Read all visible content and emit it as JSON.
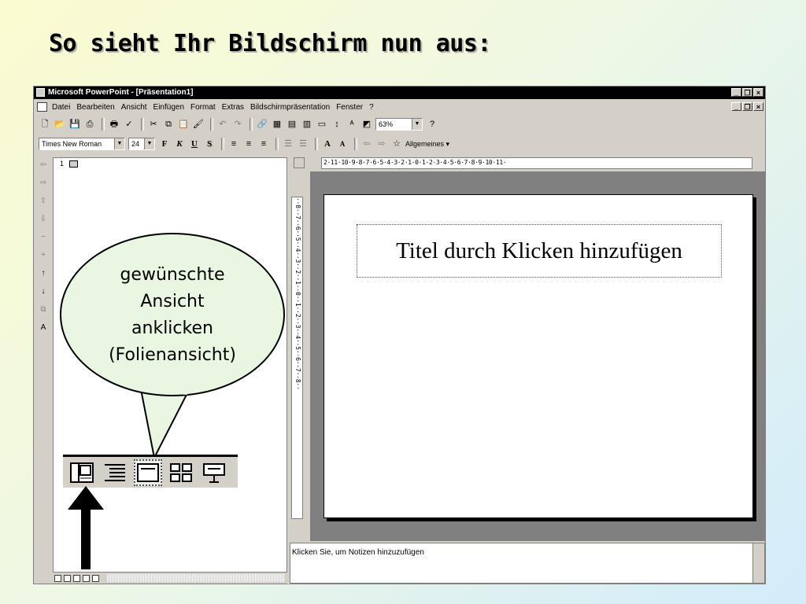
{
  "page": {
    "heading": "So sieht Ihr Bildschirm nun aus:"
  },
  "window": {
    "title": "Microsoft PowerPoint - [Präsentation1]",
    "controls": [
      "_",
      "🗗",
      "×"
    ]
  },
  "menu": {
    "items": [
      "Datei",
      "Bearbeiten",
      "Ansicht",
      "Einfügen",
      "Format",
      "Extras",
      "Bildschirmpräsentation",
      "Fenster",
      "?"
    ]
  },
  "toolbar_standard": {
    "zoom": "63%"
  },
  "toolbar_format": {
    "font": "Times New Roman",
    "size": "24",
    "bold": "F",
    "italic": "K",
    "underline": "U",
    "shadow": "S",
    "design": "Allgemeines ▾"
  },
  "outline": {
    "slide_number": "1"
  },
  "ruler": {
    "horizontal": "2·11·10·9·8·7·6·5·4·3·2·1·0·1·2·3·4·5·6·7·8·9·10·11·",
    "vertical": "··8··7··6··5··4··3··2··1··0··1··2··3··4··5··6··7··8··"
  },
  "slide": {
    "title_placeholder": "Titel durch Klicken hinzufügen"
  },
  "notes": {
    "placeholder": "Klicken Sie, um Notizen hinzuzufügen"
  },
  "callout": {
    "lines": [
      "gewünschte",
      "Ansicht",
      "anklicken",
      "(Folienansicht)"
    ]
  },
  "views": [
    {
      "name": "Normalansicht",
      "icon": "normal-view-icon"
    },
    {
      "name": "Gliederungsansicht",
      "icon": "outline-view-icon"
    },
    {
      "name": "Folienansicht",
      "icon": "slide-view-icon",
      "active": true
    },
    {
      "name": "Foliensortierung",
      "icon": "slide-sorter-icon"
    },
    {
      "name": "Bildschirmpräsentation",
      "icon": "slideshow-icon"
    }
  ],
  "colors": {
    "background_start": "#fbfbd0",
    "background_end": "#d2ecfb",
    "callout_fill": "#e9f6e2",
    "window": "#d4d0c8"
  }
}
